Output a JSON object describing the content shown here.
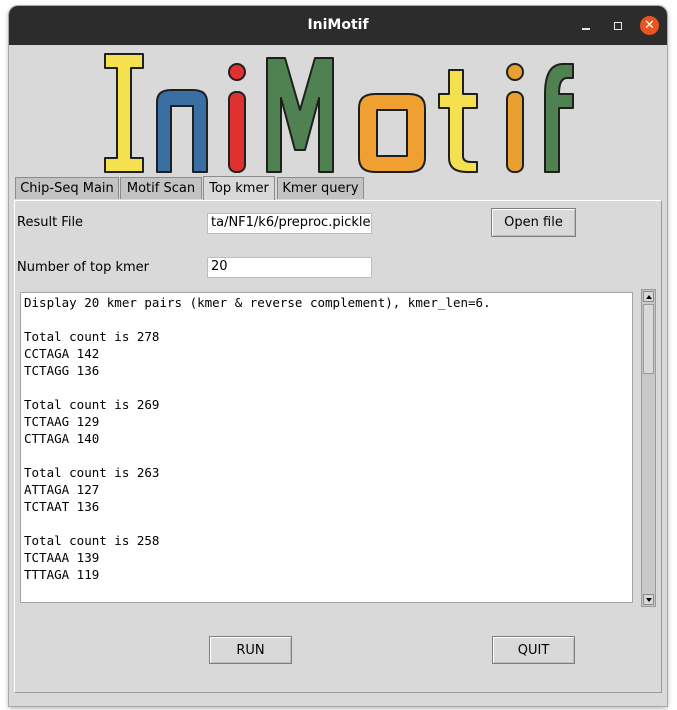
{
  "window": {
    "title": "IniMotif"
  },
  "titlebar": {
    "minimize_icon": "minimize-icon",
    "maximize_icon": "maximize-icon",
    "close_icon": "close-icon"
  },
  "logo": {
    "text": "IniMotif",
    "letters": [
      {
        "char": "I",
        "color": "#f5e050"
      },
      {
        "char": "n",
        "color": "#3a6fa3"
      },
      {
        "char": "i",
        "color": "#e03030"
      },
      {
        "char": "M",
        "color": "#4f8250"
      },
      {
        "char": "o",
        "color": "#f0a030"
      },
      {
        "char": "t",
        "color": "#f5e050"
      },
      {
        "char": "i",
        "color": "#e8a030"
      },
      {
        "char": "f",
        "color": "#4f8250"
      }
    ]
  },
  "tabs": [
    {
      "label": "Chip-Seq Main",
      "active": false
    },
    {
      "label": "Motif Scan",
      "active": false
    },
    {
      "label": "Top kmer",
      "active": true
    },
    {
      "label": "Kmer query",
      "active": false
    }
  ],
  "form": {
    "result_file_label": "Result File",
    "result_file_value": "ta/NF1/k6/preproc.pickle",
    "open_file_button": "Open file",
    "top_kmer_label": "Number of top kmer",
    "top_kmer_value": "20"
  },
  "output": {
    "lines": [
      "Display 20 kmer pairs (kmer & reverse complement), kmer_len=6.",
      "",
      "Total count is 278",
      "CCTAGA 142",
      "TCTAGG 136",
      "",
      "Total count is 269",
      "TCTAAG 129",
      "CTTAGA 140",
      "",
      "Total count is 263",
      "ATTAGA 127",
      "TCTAAT 136",
      "",
      "Total count is 258",
      "TCTAAA 139",
      "TTTAGA 119"
    ]
  },
  "actions": {
    "run_button": "RUN",
    "quit_button": "QUIT"
  }
}
